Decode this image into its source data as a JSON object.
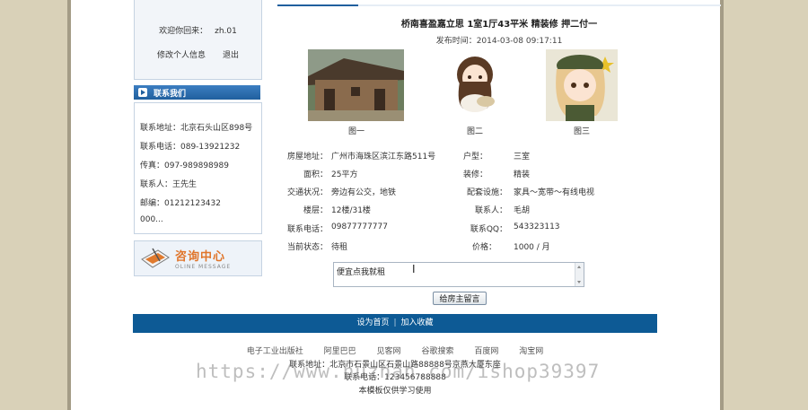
{
  "sidebar": {
    "welcome_text": "欢迎你回来：",
    "username": "zh.01",
    "edit_profile": "修改个人信息",
    "logout": "退出",
    "contact_title": "联系我们",
    "contact_lines": [
      "联系地址：北京石头山区898号",
      "联系电话：089-13921232",
      "传真：097-989898989",
      "联系人：王先生",
      "邮编：01212123432",
      "000..."
    ],
    "consult_cn": "咨询中心",
    "consult_en": "OLINE MESSAGE"
  },
  "listing": {
    "title": "桥南喜盈嘉立思  1室1厅43平米  精装修  押二付一",
    "publish_time": "发布时间：2014-03-08  09:17:11",
    "photos": [
      {
        "caption": "图一",
        "icon": "house-photo"
      },
      {
        "caption": "图二",
        "icon": "girl-avatar"
      },
      {
        "caption": "图三",
        "icon": "soldier-girl-avatar"
      }
    ],
    "fields": {
      "address_label": "房屋地址：",
      "address": "广州市海珠区滨江东路511号",
      "type_label": "户型：",
      "type": "三室",
      "area_label": "面积：",
      "area": "25平方",
      "decor_label": "装修：",
      "decor": "精装",
      "traffic_label": "交通状况：",
      "traffic": "旁边有公交，地铁",
      "facility_label": "配套设施：",
      "facility": "家具～宽带～有线电视",
      "floor_label": "楼层：",
      "floor": "12楼/31楼",
      "contact_label": "联系人：",
      "contact": "毛胡",
      "phone_label": "联系电话：",
      "phone": "09877777777",
      "qq_label": "联系QQ：",
      "qq": "543323113",
      "status_label": "当前状态：",
      "status": "待租",
      "price_label": "价格：",
      "price": "1000 / 月"
    },
    "message_value": "便宜点我就租",
    "submit_label": "给房主留言"
  },
  "footer": {
    "set_home": "设为首页",
    "add_favorite": "加入收藏",
    "links": [
      "电子工业出版社",
      "阿里巴巴",
      "见客网",
      "谷歌搜索",
      "百度网",
      "淘宝网"
    ],
    "address": "联系地址：北京市石景山区石景山路88888号京燕大厦东座",
    "phone": "联系电话：123456788888",
    "note": "本模板仅供学习使用"
  },
  "watermark": "https://www.huzhan.com/ishop39397",
  "colors": {
    "accent": "#0d5a95",
    "consult_orange": "#e0752a",
    "side_bg": "#d9d1b8"
  }
}
